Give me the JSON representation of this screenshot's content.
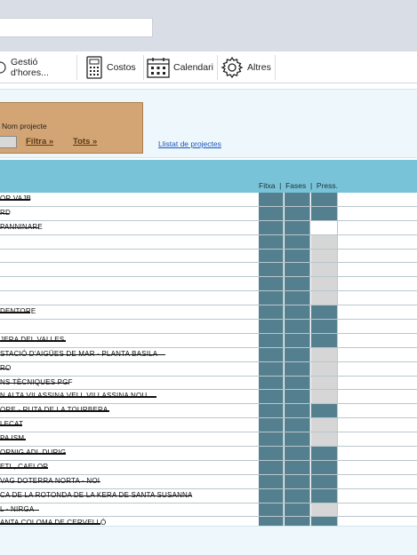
{
  "tabs": [
    {
      "label": "Gestió d'hores...",
      "icon": "clock-icon"
    },
    {
      "label": "Costos",
      "icon": "calculator-icon"
    },
    {
      "label": "Calendari",
      "icon": "calendar-icon"
    },
    {
      "label": "Altres",
      "icon": "gear-icon"
    }
  ],
  "filter": {
    "label": "Nom projecte",
    "filter_link": "Filtra »",
    "all_link": "Tots »",
    "list_link": "Llistat de projectes"
  },
  "table": {
    "header": "Fitxa  |  Fases  |  Press.",
    "rows": [
      {
        "name": "OR VAJB",
        "press": "dark"
      },
      {
        "name": "RD",
        "press": "dark"
      },
      {
        "name": "PANNINARE",
        "press": "white"
      },
      {
        "name": "",
        "press": "grey"
      },
      {
        "name": "",
        "press": "grey"
      },
      {
        "name": "",
        "press": "grey"
      },
      {
        "name": "",
        "press": "grey"
      },
      {
        "name": "",
        "press": "grey"
      },
      {
        "name": "DENTORE",
        "press": "dark"
      },
      {
        "name": "",
        "press": "dark"
      },
      {
        "name": "JERA DEL VALLES",
        "press": "dark"
      },
      {
        "name": "STACIÓ D'AIGÜES DE MAR - PLANTA BASILA",
        "press": "grey"
      },
      {
        "name": "RO",
        "press": "grey"
      },
      {
        "name": "NS TÈCNIQUES PGF",
        "press": "grey"
      },
      {
        "name": "N ALTA VILASSINA VELL VILLASSINA NOU",
        "press": "grey"
      },
      {
        "name": "ORE - RUTA DE LA TOURBERA",
        "press": "dark"
      },
      {
        "name": "LECAT",
        "press": "grey"
      },
      {
        "name": "PA ISM",
        "press": "grey"
      },
      {
        "name": "ORNIG ADL DURIG",
        "press": "dark"
      },
      {
        "name": "ETL, CAELOR",
        "press": "dark"
      },
      {
        "name": "VAG DOTERRA NORTA - NOI",
        "press": "dark"
      },
      {
        "name": "CA DE LA ROTONDA DE LA KERA DE SANTA SUSANNA",
        "press": "dark"
      },
      {
        "name": "L - NIRGA",
        "press": "grey"
      },
      {
        "name": "ANTA COLOMA DE CERVELLÓ",
        "press": "dark"
      }
    ]
  }
}
